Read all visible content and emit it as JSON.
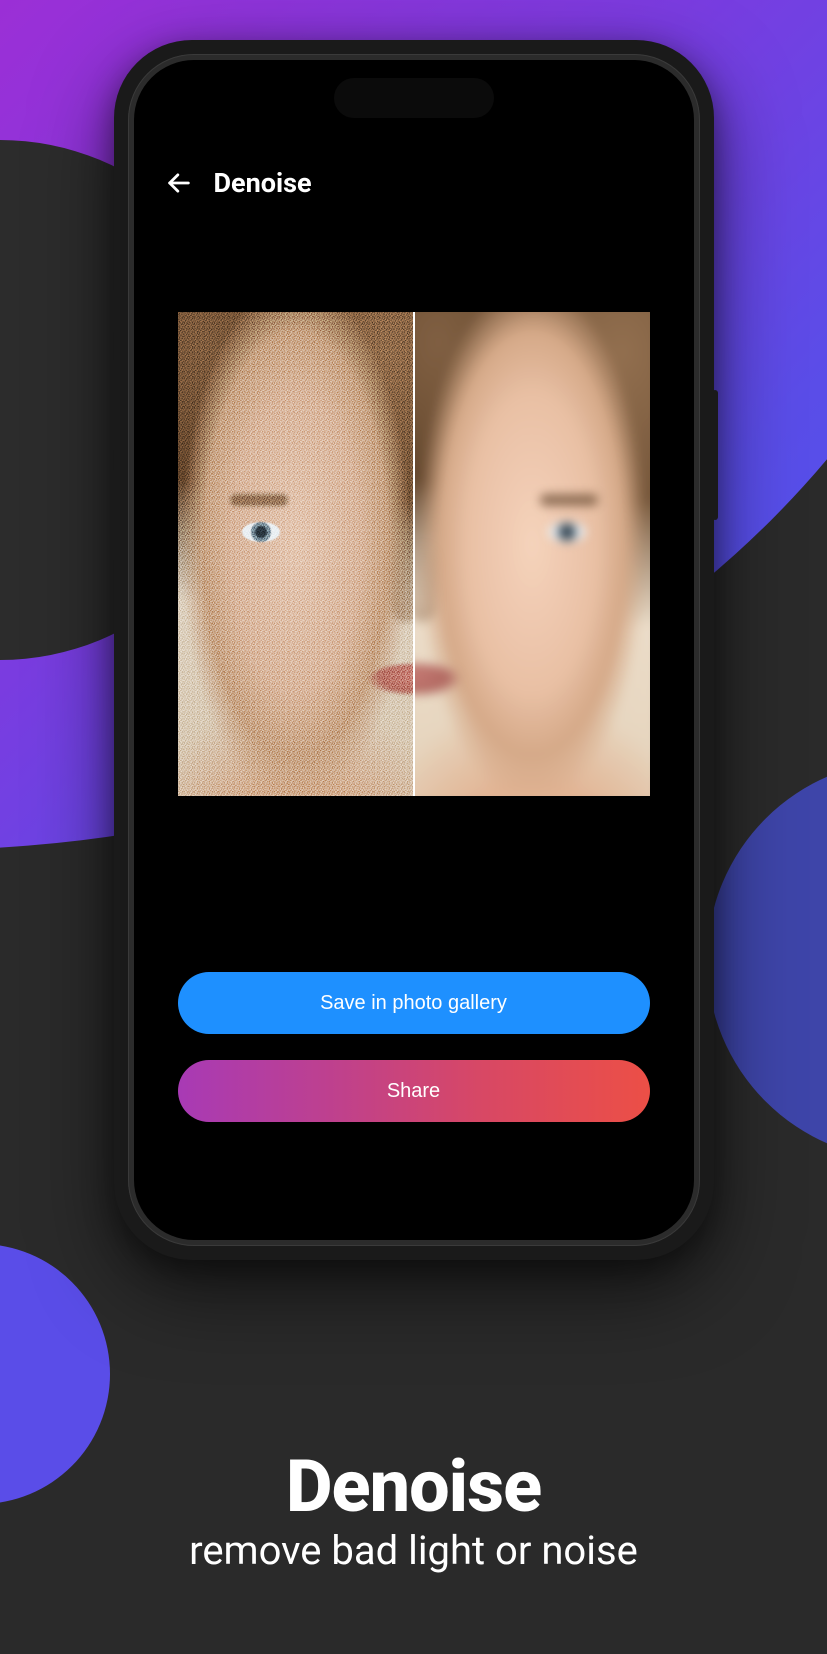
{
  "header": {
    "title": "Denoise"
  },
  "actions": {
    "save_label": "Save in photo gallery",
    "share_label": "Share"
  },
  "promo": {
    "title": "Denoise",
    "subtitle": "remove bad light or noise"
  },
  "colors": {
    "save_button": "#1e90ff",
    "share_gradient_start": "#a83ab5",
    "share_gradient_end": "#ec4f46"
  },
  "icons": {
    "back": "arrow-left-icon"
  }
}
